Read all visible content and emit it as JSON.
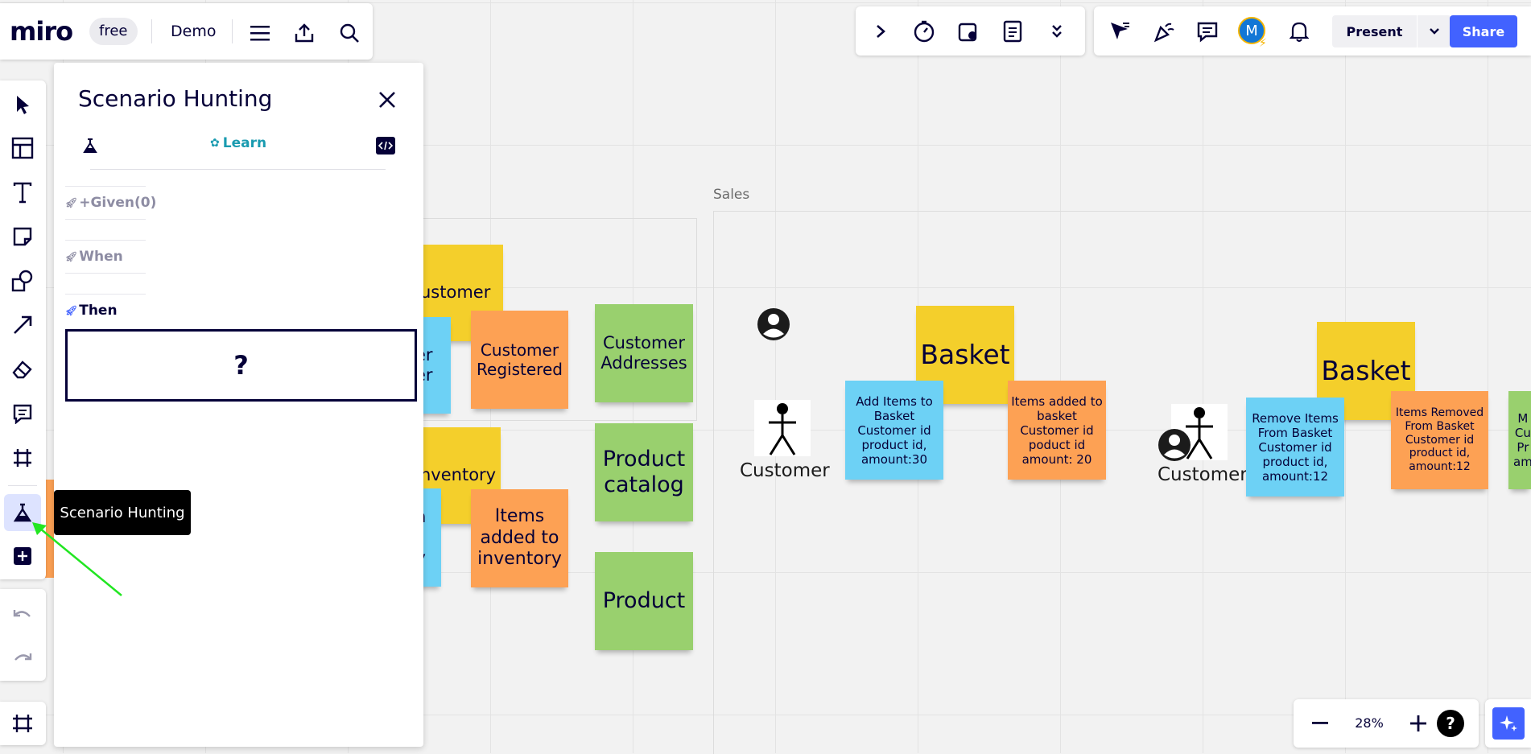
{
  "app": {
    "logo": "miro",
    "plan_badge": "free",
    "board_name": "Demo"
  },
  "top_right": {
    "present_label": "Present",
    "share_label": "Share",
    "avatar_initial": "M"
  },
  "panel": {
    "title": "Scenario Hunting",
    "learn_label": "Learn",
    "given_label": "+Given(0)",
    "when_label": "When",
    "then_label": "Then",
    "placeholder": "?"
  },
  "tooltip": "Scenario Hunting",
  "canvas": {
    "frame_label": "Sales",
    "stickies": {
      "customer_partial": "ustomer",
      "blue_partial_1": "er\ner",
      "customer_registered": "Customer\nRegistered",
      "customer_addresses": "Customer\nAddresses",
      "inventory_partial": "nventory",
      "blue_partial_2": "n\n\ny",
      "items_added_to_inventory": "Items\nadded to\ninventory",
      "product_catalog": "Product\ncatalog",
      "product": "Product",
      "basket_1": "Basket",
      "add_items": "Add Items to\nBasket\nCustomer id\nproduct id,\namount:30",
      "items_added_basket": "Items added to\nbasket\nCustomer id\npoduct id\namount: 20",
      "basket_2": "Basket",
      "remove_items": "Remove Items\nFrom Basket\nCustomer id\nproduct id,\namount:12",
      "items_removed": "Items Removed\nFrom Basket\nCustomer id\nproduct id,\namount:12",
      "green_partial_right": "M\nCu\nPr\nam"
    },
    "actor_1_label": "Customer",
    "actor_2_label": "Customer"
  },
  "zoom": {
    "level": "28%"
  },
  "colors": {
    "accent": "#4262ff",
    "teal": "#1a9bb0",
    "yellow": "#f4cf2b",
    "orange": "#fda154",
    "green": "#99d06e",
    "blue": "#6dd1f5"
  }
}
